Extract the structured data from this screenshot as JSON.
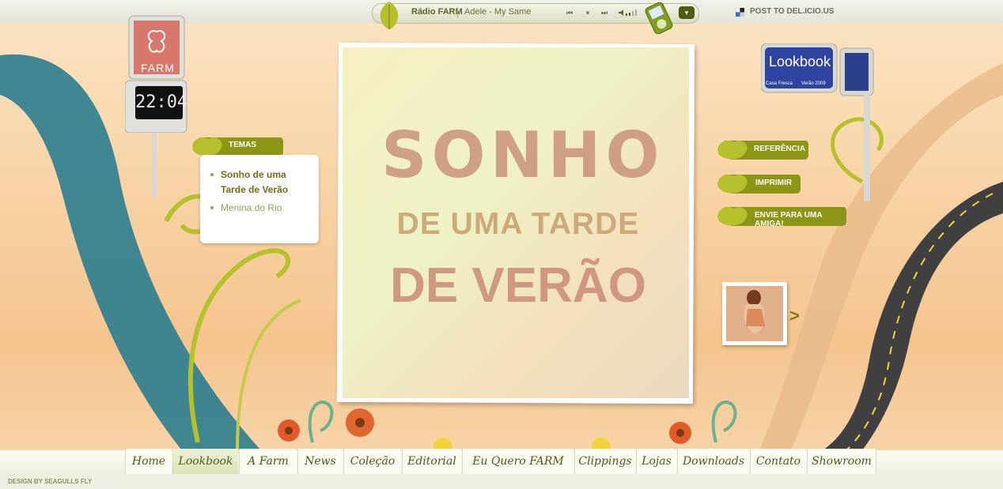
{
  "radio": {
    "title": "Rádio FARM",
    "track": "Adele - My Same",
    "controls": {
      "prev": "⏮",
      "pause": "⏸",
      "next": "⏭"
    }
  },
  "share": {
    "label": "POST TO DEL.ICIO.US"
  },
  "farm_sign": {
    "logo_text": "FARM",
    "clock": "22:04"
  },
  "temas": {
    "label": "TEMAS",
    "items": [
      {
        "label": "Sonho de uma Tarde de Verão",
        "active": true
      },
      {
        "label": "Menina do Rio",
        "active": false
      }
    ]
  },
  "hero": {
    "line1": "SONHO",
    "line2": "DE UMA TARDE",
    "line3": "DE VERÃO"
  },
  "lookbook": {
    "label": "Lookbook",
    "sub_left": "Casa Fresca",
    "sub_right": "Verão 2009"
  },
  "actions": {
    "referencia": "REFERÊNCIA",
    "imprimir": "IMPRIMIR",
    "enviar": "ENVIE PARA UMA AMIGA!"
  },
  "nav": [
    "Home",
    "Lookbook",
    "A Farm",
    "News",
    "Coleção",
    "Editorial",
    "Eu Quero FARM",
    "Clippings",
    "Lojas",
    "Downloads",
    "Contato",
    "Showroom"
  ],
  "footer": {
    "credit": "DESIGN BY SEAGULLS FLY"
  },
  "colors": {
    "accent_green": "#b6c02c",
    "dark_green": "#5a6320",
    "teal": "#2b7d8f"
  }
}
